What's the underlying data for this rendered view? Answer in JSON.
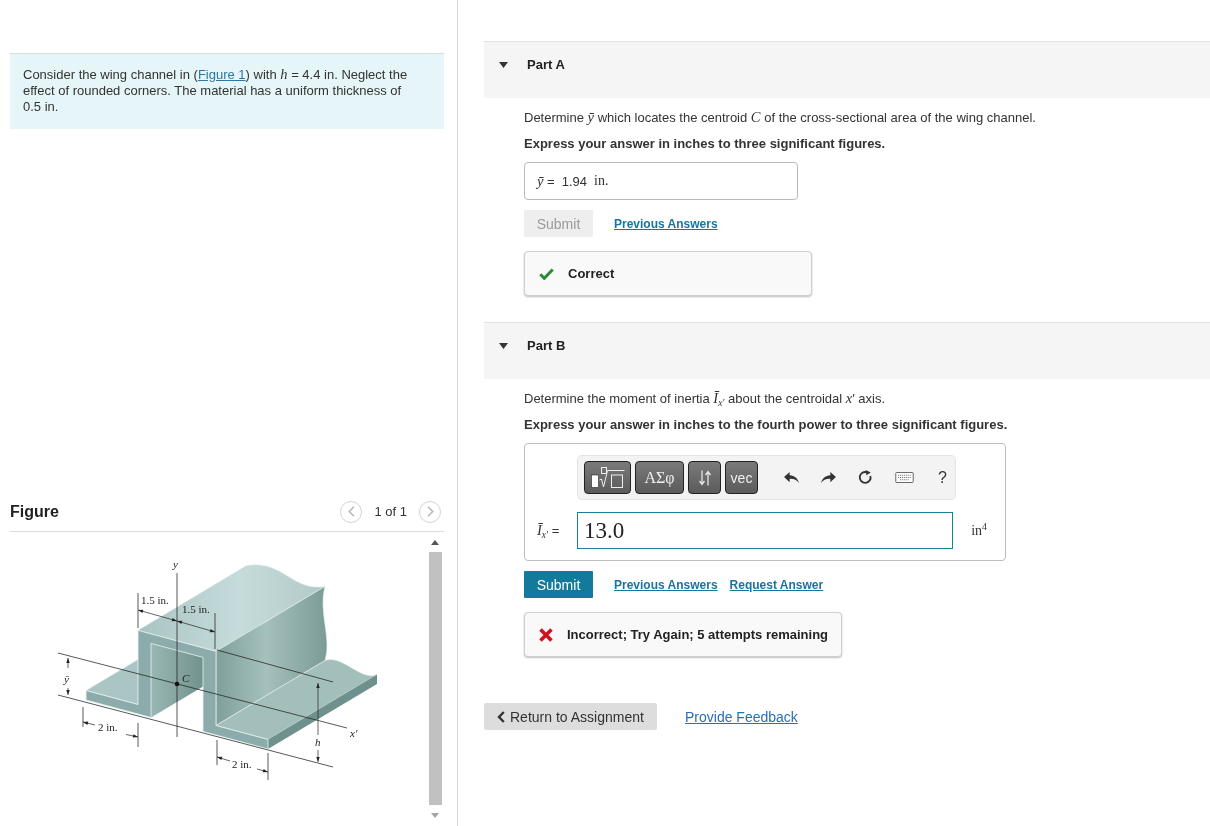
{
  "problem": {
    "text_before": "Consider the wing channel in (",
    "link": "Figure 1",
    "text_after": ") with *h* = 4.4 in. Neglect the effect of rounded corners. The material has a uniform thickness of 0.5 in."
  },
  "figure_panel": {
    "title": "Figure",
    "pager": {
      "text": "1 of 1",
      "prev_disabled": true,
      "next_disabled": true
    },
    "labels": [
      {
        "kind": "variable",
        "text": "y"
      },
      {
        "kind": "dimension",
        "text": "1.5 in."
      },
      {
        "kind": "dimension",
        "text": "1.5 in."
      },
      {
        "kind": "variable",
        "text": "C"
      },
      {
        "kind": "variable",
        "text": "ȳ"
      },
      {
        "kind": "dimension",
        "text": "2 in."
      },
      {
        "kind": "variable",
        "text": "h"
      },
      {
        "kind": "variable",
        "text": "x′"
      },
      {
        "kind": "dimension",
        "text": "2 in."
      }
    ]
  },
  "parts": [
    {
      "title": "Part A",
      "expanded": true,
      "prompt": "Determine *ȳ* which locates the centroid *C* of the cross-sectional area of the wing channel.",
      "instruction": "Express your answer in inches to three significant figures.",
      "answer": {
        "kind": "display",
        "label": "*ȳ* =",
        "value": "1.94",
        "unit": "in."
      },
      "submit": {
        "label": "Submit",
        "disabled": true
      },
      "links": [
        "Previous Answers"
      ],
      "feedback": {
        "kind": "correct",
        "text": "Correct"
      }
    },
    {
      "title": "Part B",
      "expanded": true,
      "prompt": "Determine the moment of inertia *Ī*$_{x′}$ about the centroidal *x*′ axis.",
      "instruction": "Express your answer in inches to the fourth power to three significant figures.",
      "answer": {
        "kind": "editor",
        "toolbar": [
          {
            "kind": "templates"
          },
          {
            "kind": "symbols",
            "label": "ΑΣφ"
          },
          {
            "kind": "arrows"
          },
          {
            "kind": "vector",
            "label": "vec"
          },
          {
            "kind": "undo"
          },
          {
            "kind": "redo"
          },
          {
            "kind": "reset"
          },
          {
            "kind": "keyboard"
          },
          {
            "kind": "help",
            "label": "?"
          }
        ],
        "label": "*Ī*$_{x′}$ =",
        "value": "13.0",
        "unit": "in$^{4}$"
      },
      "submit": {
        "label": "Submit",
        "disabled": false
      },
      "links": [
        "Previous Answers",
        "Request Answer"
      ],
      "feedback": {
        "kind": "incorrect",
        "text": "Incorrect; Try Again; 5 attempts remaining"
      }
    }
  ],
  "footer": {
    "return_button": "Return to Assignment",
    "feedback_link": "Provide Feedback"
  }
}
